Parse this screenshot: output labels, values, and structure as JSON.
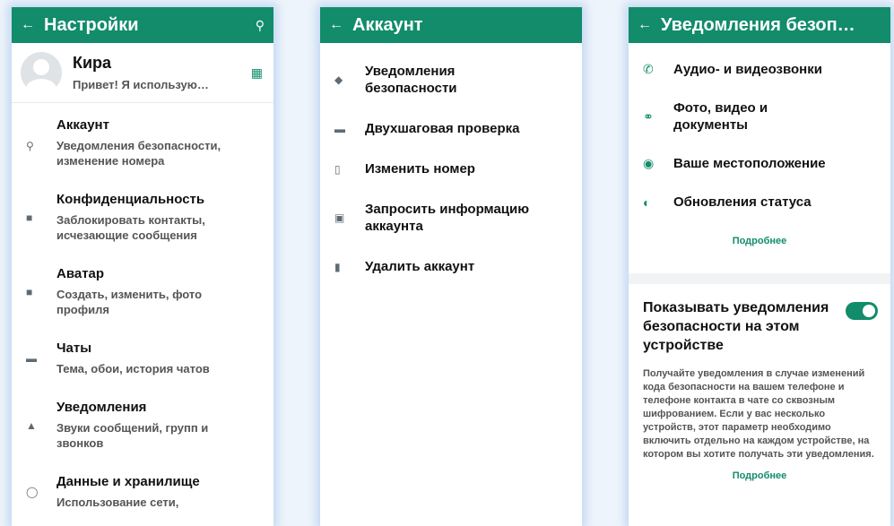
{
  "settings": {
    "title": "Настройки",
    "profile": {
      "name": "Кира",
      "status": "Привет! Я использую…"
    },
    "items": [
      {
        "title": "Аккаунт",
        "subtitle": "Уведомления безопасности, изменение номера",
        "icon": "key-icon"
      },
      {
        "title": "Конфиденциальность",
        "subtitle": "Заблокировать контакты, исчезающие сообщения",
        "icon": "lock-icon"
      },
      {
        "title": "Аватар",
        "subtitle": "Создать, изменить, фото профиля",
        "icon": "avatar-icon"
      },
      {
        "title": "Чаты",
        "subtitle": "Тема, обои, история чатов",
        "icon": "chat-icon"
      },
      {
        "title": "Уведомления",
        "subtitle": "Звуки сообщений, групп и звонков",
        "icon": "bell-icon"
      },
      {
        "title": "Данные и хранилище",
        "subtitle": "Использование сети,",
        "icon": "data-icon"
      }
    ]
  },
  "account": {
    "title": "Аккаунт",
    "items": [
      {
        "label": "Уведомления безопасности",
        "icon": "shield-icon"
      },
      {
        "label": "Двухшаговая проверка",
        "icon": "pin-dots-icon"
      },
      {
        "label": "Изменить номер",
        "icon": "phone-change-icon"
      },
      {
        "label": "Запросить информацию аккаунта",
        "icon": "document-icon"
      },
      {
        "label": "Удалить аккаунт",
        "icon": "trash-icon"
      }
    ]
  },
  "security": {
    "title": "Уведомления безоп…",
    "items": [
      {
        "label": "Аудио- и видеозвонки",
        "icon": "phone-icon"
      },
      {
        "label": "Фото, видео и документы",
        "icon": "paperclip-icon"
      },
      {
        "label": "Ваше местоположение",
        "icon": "location-pin-icon"
      },
      {
        "label": "Обновления статуса",
        "icon": "status-icon"
      }
    ],
    "more_label": "Подробнее",
    "toggle_label": "Показывать уведомления безопасности на этом устройстве",
    "toggle_on": true,
    "description": "Получайте уведомления в случае изменений кода безопасности на вашем телефоне и телефоне контакта в чате со сквозным шифрованием. Если у вас несколько устройств, этот параметр необходимо включить отдельно на каждом устройстве, на котором вы хотите получать эти уведомления.",
    "more_label_2": "Подробнее"
  },
  "colors": {
    "accent": "#128c6b",
    "background": "#eef4fb"
  }
}
